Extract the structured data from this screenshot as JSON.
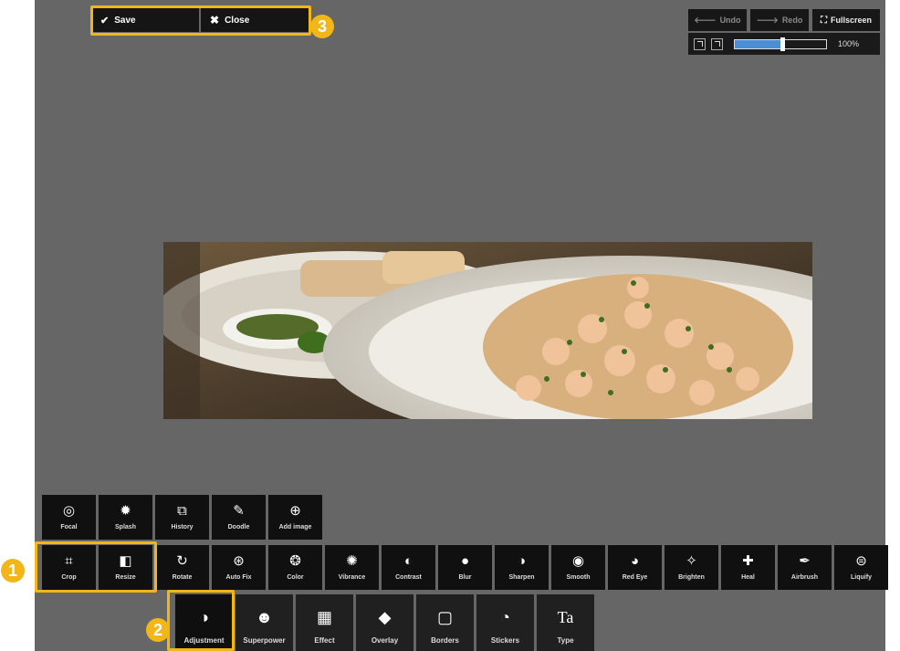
{
  "topbar": {
    "save_label": "Save",
    "close_label": "Close"
  },
  "history": {
    "undo_label": "Undo",
    "redo_label": "Redo",
    "fullscreen_label": "Fullscreen"
  },
  "zoom": {
    "value_label": "100%",
    "slider_fraction": 0.52
  },
  "badges": [
    "1",
    "2",
    "3"
  ],
  "tools_row1": [
    {
      "label": "Focal",
      "icon": "focal-icon"
    },
    {
      "label": "Splash",
      "icon": "splash-icon"
    },
    {
      "label": "History",
      "icon": "history-icon"
    },
    {
      "label": "Doodle",
      "icon": "doodle-icon"
    },
    {
      "label": "Add image",
      "icon": "add-image-icon"
    }
  ],
  "tools_row2": [
    {
      "label": "Crop",
      "icon": "crop-icon"
    },
    {
      "label": "Resize",
      "icon": "resize-icon"
    },
    {
      "label": "Rotate",
      "icon": "rotate-icon"
    },
    {
      "label": "Auto Fix",
      "icon": "auto-fix-icon"
    },
    {
      "label": "Color",
      "icon": "color-icon"
    },
    {
      "label": "Vibrance",
      "icon": "vibrance-icon"
    },
    {
      "label": "Contrast",
      "icon": "contrast-icon"
    },
    {
      "label": "Blur",
      "icon": "blur-icon"
    },
    {
      "label": "Sharpen",
      "icon": "sharpen-icon"
    },
    {
      "label": "Smooth",
      "icon": "smooth-icon"
    },
    {
      "label": "Red Eye",
      "icon": "red-eye-icon"
    },
    {
      "label": "Brighten",
      "icon": "brighten-icon"
    },
    {
      "label": "Heal",
      "icon": "heal-icon"
    },
    {
      "label": "Airbrush",
      "icon": "airbrush-icon"
    },
    {
      "label": "Liquify",
      "icon": "liquify-icon"
    }
  ],
  "tabs": [
    {
      "label": "Adjustment",
      "icon": "adjustment-icon",
      "active": true
    },
    {
      "label": "Superpower",
      "icon": "superpower-icon"
    },
    {
      "label": "Effect",
      "icon": "effect-icon"
    },
    {
      "label": "Overlay",
      "icon": "overlay-icon"
    },
    {
      "label": "Borders",
      "icon": "borders-icon"
    },
    {
      "label": "Stickers",
      "icon": "stickers-icon"
    },
    {
      "label": "Type",
      "icon": "type-icon"
    }
  ],
  "colors": {
    "highlight": "#f2b619",
    "canvas": "#666666",
    "toolbar": "#101010",
    "zoom_fill": "#4a8fd6"
  }
}
